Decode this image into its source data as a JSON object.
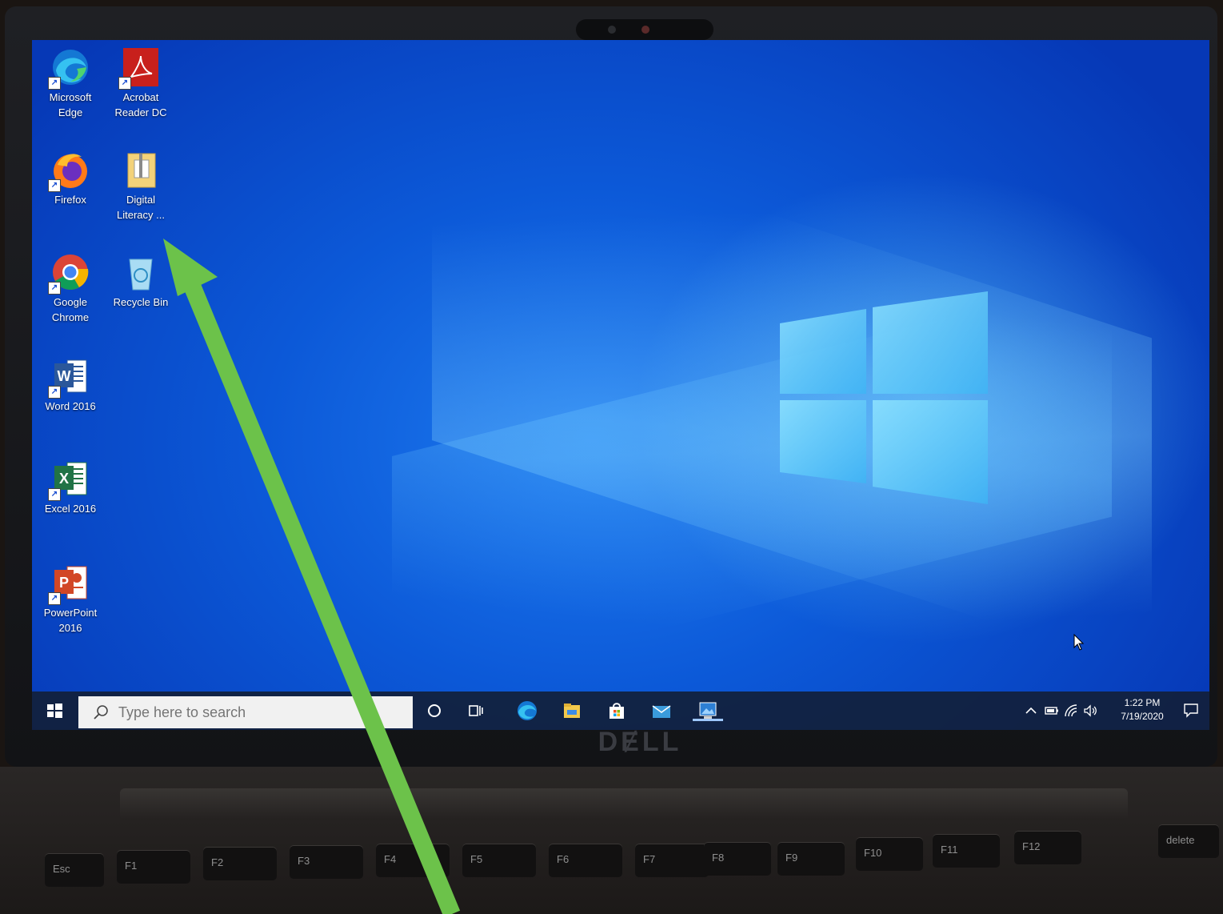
{
  "desktop": {
    "icons": [
      {
        "label": "Microsoft Edge"
      },
      {
        "label": "Acrobat Reader DC"
      },
      {
        "label": "Firefox"
      },
      {
        "label": "Digital Literacy ..."
      },
      {
        "label": "Google Chrome"
      },
      {
        "label": "Recycle Bin"
      },
      {
        "label": "Word 2016"
      },
      {
        "label": "Excel 2016"
      },
      {
        "label": "PowerPoint 2016"
      }
    ]
  },
  "taskbar": {
    "search_placeholder": "Type here to search",
    "pinned": [
      "cortana-icon",
      "task-view-icon",
      "edge-icon",
      "file-explorer-icon",
      "store-icon",
      "mail-icon",
      "photos-icon"
    ],
    "clock_time": "1:22 PM",
    "clock_date": "7/19/2020"
  },
  "keyboard": {
    "keys": [
      "Esc",
      "F1",
      "F2",
      "F3",
      "F4",
      "F5",
      "F6",
      "F7",
      "F8",
      "F9",
      "F10",
      "F11",
      "F12",
      "delete"
    ]
  },
  "colors": {
    "accent": "#1d7bf0",
    "taskbar": "#12203a",
    "arrow": "#6cc24a"
  }
}
